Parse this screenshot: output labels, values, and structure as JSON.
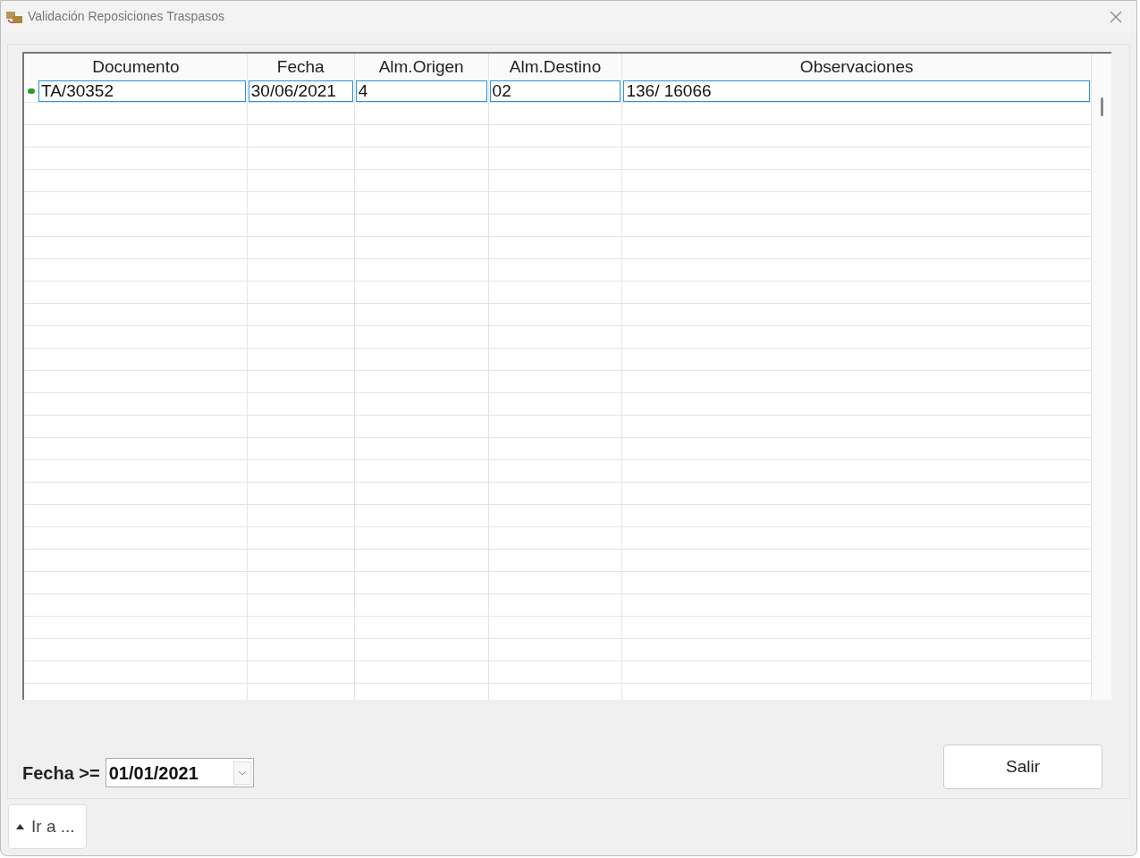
{
  "window": {
    "title": "Validación Reposiciones Traspasos"
  },
  "table": {
    "columns": [
      "Documento",
      "Fecha",
      "Alm.Origen",
      "Alm.Destino",
      "Observaciones"
    ],
    "rows": [
      {
        "selected": true,
        "cells": [
          "TA/30352",
          "30/06/2021",
          "4",
          "02",
          "136/ 16066"
        ]
      }
    ]
  },
  "filter": {
    "label": "Fecha >=",
    "value": "01/01/2021"
  },
  "buttons": {
    "exit": "Salir",
    "goto": "Ir a ..."
  }
}
